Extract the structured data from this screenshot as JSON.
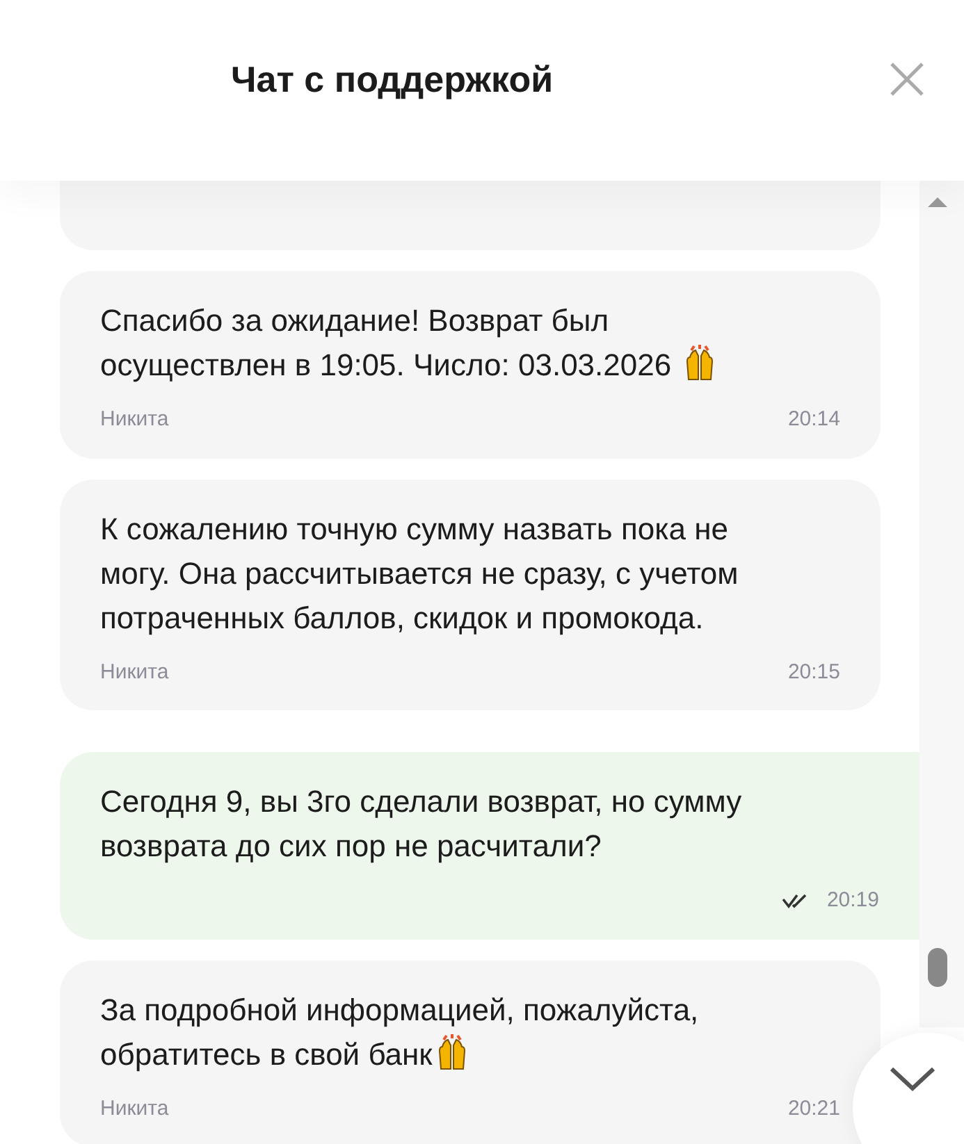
{
  "header": {
    "title": "Чат с поддержкой"
  },
  "messages": [
    {
      "kind": "incoming",
      "text": "Спасибо за ожидание! Возврат был осуществлен в 19:05. Число: 03.03.2026 ",
      "emoji": true,
      "author": "Никита",
      "time": "20:14"
    },
    {
      "kind": "incoming",
      "text": "К сожалению точную сумму назвать пока не могу. Она рассчитывается не сразу, с учетом потраченных баллов, скидок и промокода.",
      "emoji": false,
      "author": "Никита",
      "time": "20:15"
    },
    {
      "kind": "outgoing",
      "text": "Сегодня 9, вы 3го сделали возврат, но сумму возврата до сих пор не расчитали?",
      "emoji": false,
      "read": true,
      "time": "20:19"
    },
    {
      "kind": "incoming",
      "text": "За подробной информацией, пожалуйста, обратитесь в свой банк",
      "emoji": true,
      "author": "Никита",
      "time": "20:21"
    }
  ]
}
